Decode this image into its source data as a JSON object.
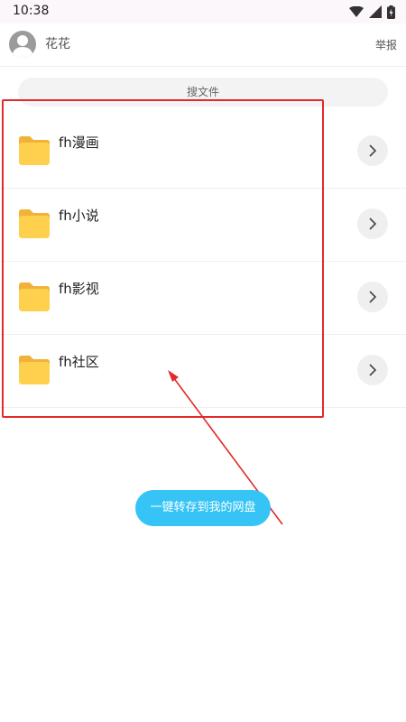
{
  "status_bar": {
    "time": "10:38"
  },
  "header": {
    "user_name": "花花",
    "report_label": "举报"
  },
  "search": {
    "placeholder": "搜文件"
  },
  "files": [
    {
      "name": "fh漫画",
      "icon": "folder-icon"
    },
    {
      "name": "fh小说",
      "icon": "folder-icon"
    },
    {
      "name": "fh影视",
      "icon": "folder-icon"
    },
    {
      "name": "fh社区",
      "icon": "folder-icon"
    }
  ],
  "cta": {
    "label": "一键转存到我的网盘"
  },
  "colors": {
    "accent": "#36c4f6",
    "folder": "#ffd04d",
    "annotation": "#e32a2a"
  }
}
